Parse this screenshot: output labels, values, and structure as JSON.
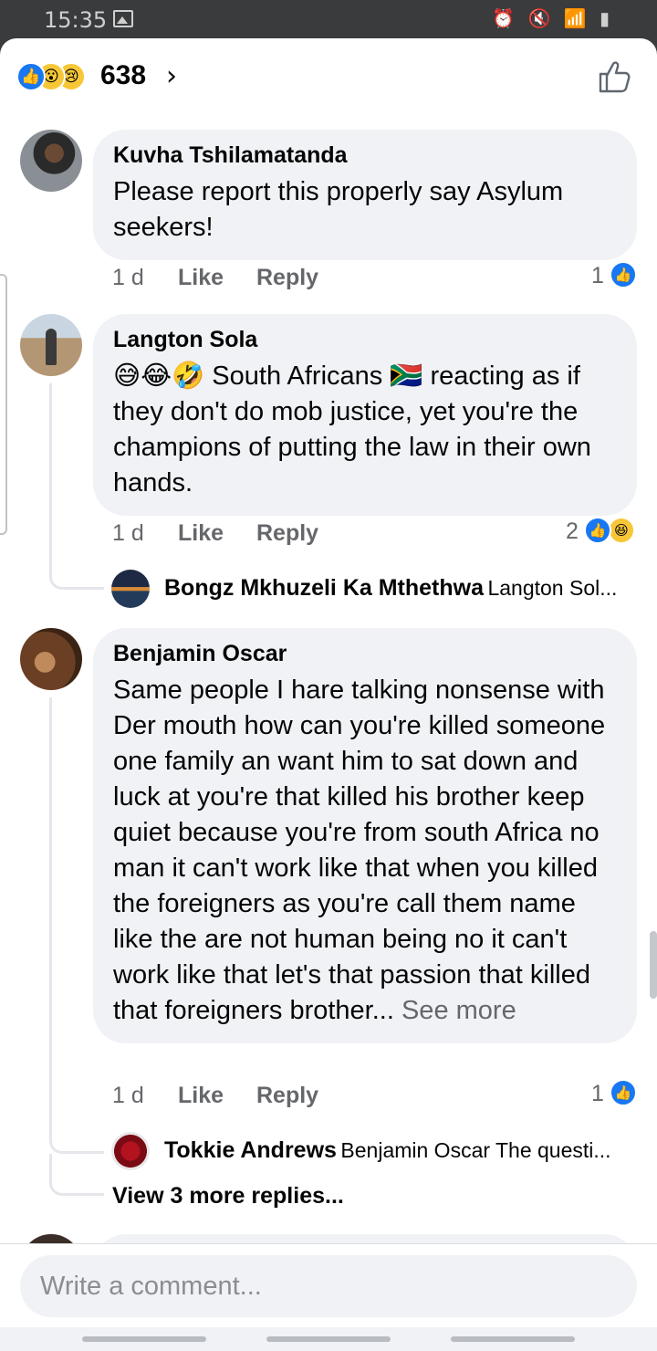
{
  "status_bar": {
    "time": "15:35",
    "system_icons": "⏰ 🔇 📶 ▮"
  },
  "reactions_header": {
    "reaction_icons": [
      "like-icon",
      "wow-icon",
      "sad-icon"
    ],
    "count": "638",
    "chevron": "›"
  },
  "comments": [
    {
      "author": "Kuvha Tshilamatanda",
      "text": "Please report this properly say Asylum seekers!",
      "time": "1 d",
      "like_label": "Like",
      "reply_label": "Reply",
      "reaction_count": "1",
      "reactions": [
        "like-icon"
      ]
    },
    {
      "author": "Langton Sola",
      "text": "😅😂🤣 South Africans 🇿🇦 reacting as if they don't do mob justice, yet you're the champions of putting the law in their own hands.",
      "time": "1 d",
      "like_label": "Like",
      "reply_label": "Reply",
      "reaction_count": "2",
      "reactions": [
        "like-icon",
        "haha-icon"
      ],
      "reply_preview": {
        "author": "Bongz Mkhuzeli Ka Mthethwa",
        "snippet": "Langton Sol..."
      }
    },
    {
      "author": "Benjamin Oscar",
      "text": "Same people I hare talking nonsense with Der mouth how can you're killed someone one family an want him to sat down and luck at you're that killed his brother keep quiet because you're from south Africa no man it can't work like that when you killed the foreigners as you're call them name like the are not human being no it can't work like that let's that passion that killed that foreigners brother...",
      "see_more": "See more",
      "time": "1 d",
      "like_label": "Like",
      "reply_label": "Reply",
      "reaction_count": "1",
      "reactions": [
        "like-icon"
      ],
      "reply_preview": {
        "author": "Tokkie Andrews",
        "snippet": "Benjamin Oscar The questi..."
      },
      "view_more_replies": "View 3 more replies..."
    }
  ],
  "composer": {
    "placeholder": "Write a comment..."
  },
  "colors": {
    "accent": "#1877f2",
    "bubble": "#f0f2f5",
    "muted_text": "#65676b",
    "text": "#050505"
  }
}
